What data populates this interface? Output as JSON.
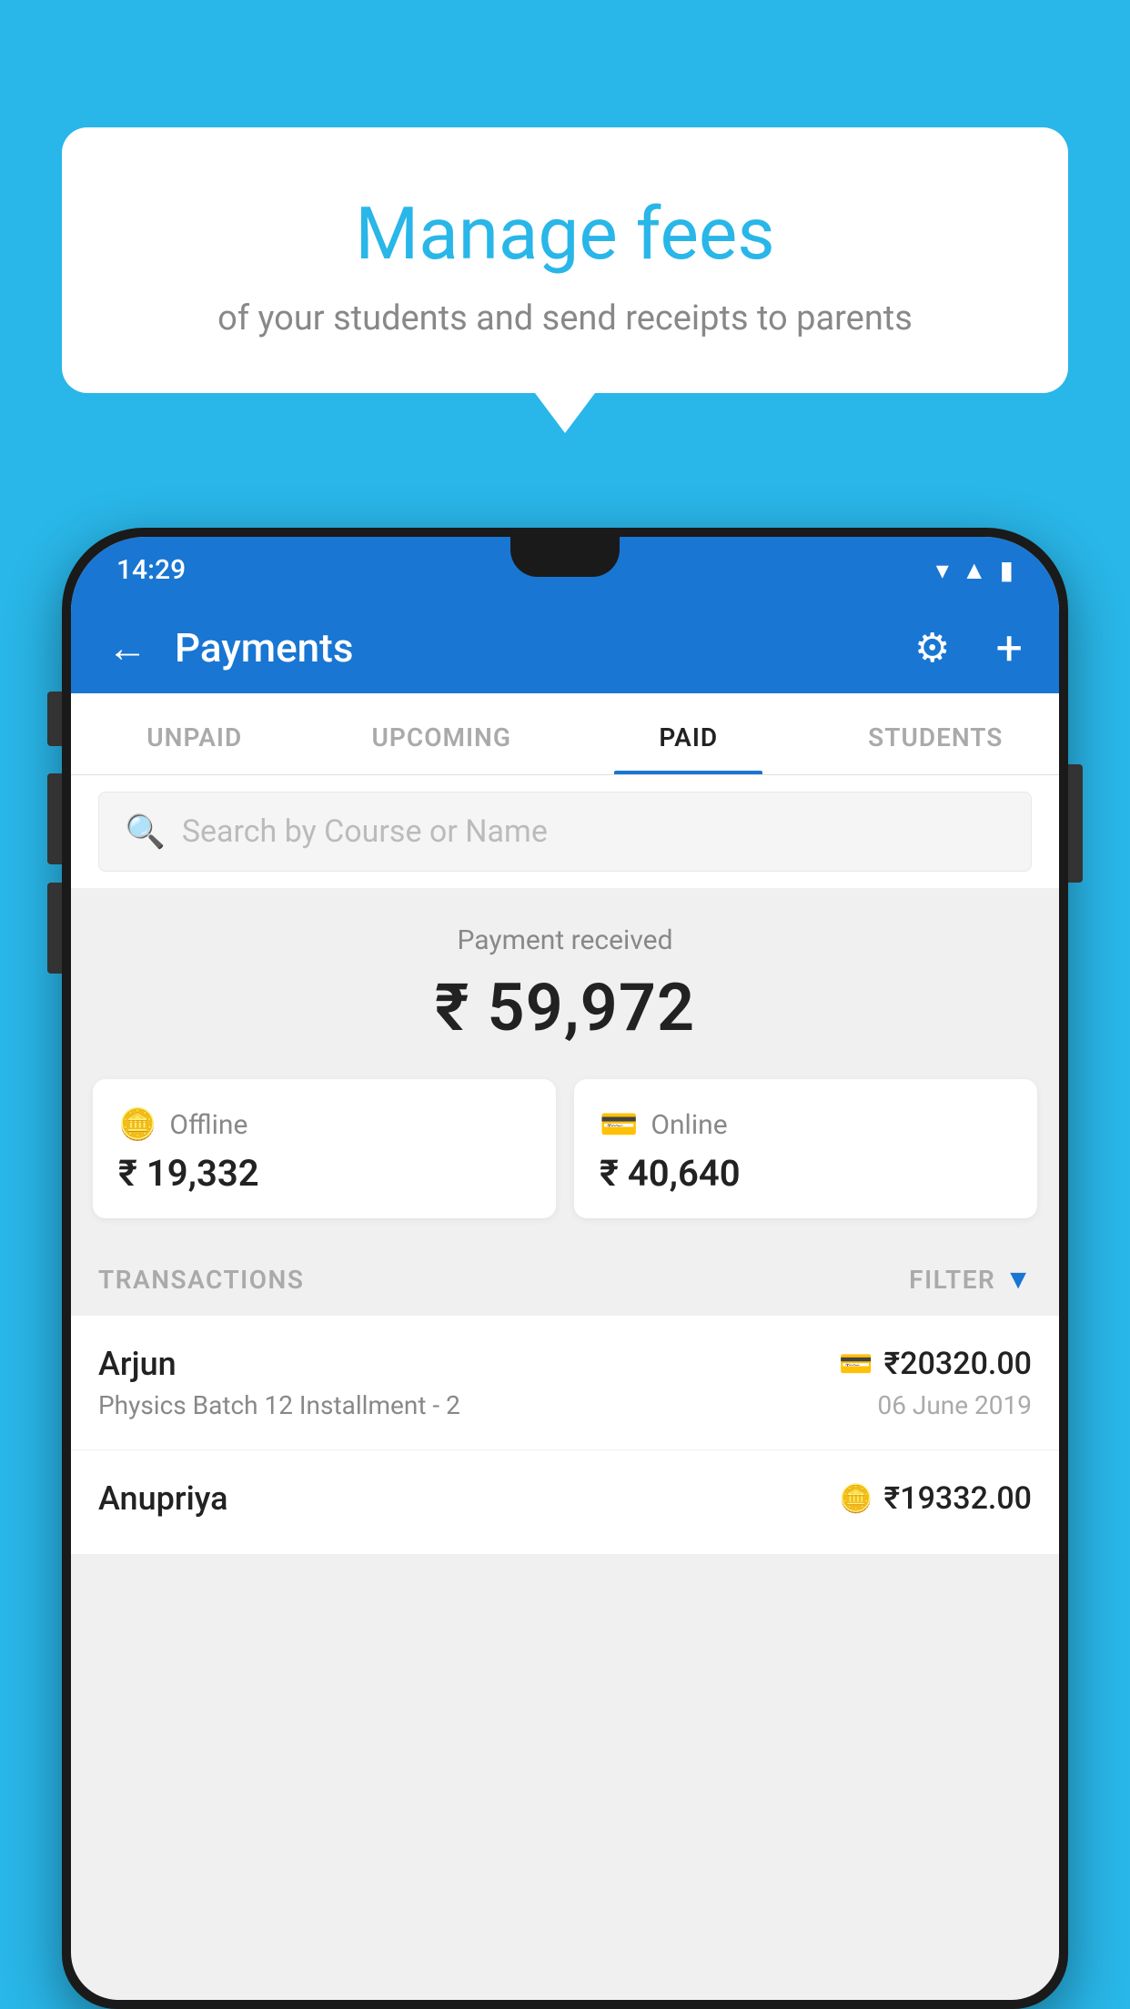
{
  "background_color": "#29B6E8",
  "speech_bubble": {
    "title": "Manage fees",
    "subtitle": "of your students and send receipts to parents"
  },
  "phone": {
    "status_bar": {
      "time": "14:29",
      "icons": [
        "wifi",
        "signal",
        "battery"
      ]
    },
    "header": {
      "title": "Payments",
      "back_label": "←",
      "gear_label": "⚙",
      "plus_label": "+"
    },
    "tabs": [
      {
        "label": "UNPAID",
        "active": false
      },
      {
        "label": "UPCOMING",
        "active": false
      },
      {
        "label": "PAID",
        "active": true
      },
      {
        "label": "STUDENTS",
        "active": false
      }
    ],
    "search": {
      "placeholder": "Search by Course or Name"
    },
    "payment_summary": {
      "label": "Payment received",
      "amount": "₹ 59,972",
      "offline_label": "Offline",
      "offline_amount": "₹ 19,332",
      "online_label": "Online",
      "online_amount": "₹ 40,640"
    },
    "transactions": {
      "section_label": "TRANSACTIONS",
      "filter_label": "FILTER",
      "items": [
        {
          "name": "Arjun",
          "course": "Physics Batch 12 Installment - 2",
          "amount": "₹20320.00",
          "date": "06 June 2019",
          "payment_type": "online"
        },
        {
          "name": "Anupriya",
          "course": "",
          "amount": "₹19332.00",
          "date": "",
          "payment_type": "offline"
        }
      ]
    }
  }
}
